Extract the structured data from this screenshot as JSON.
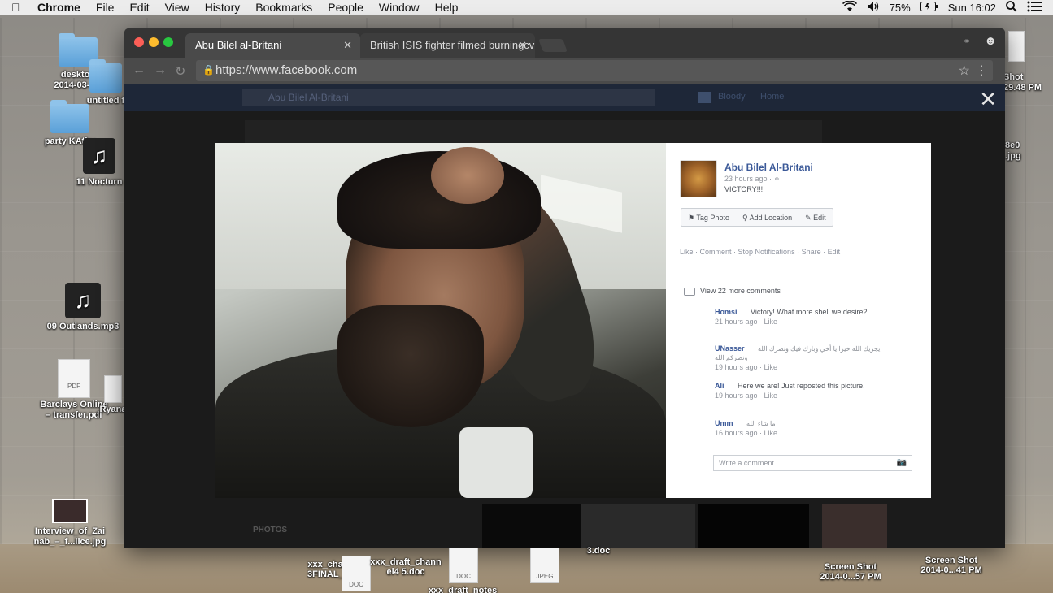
{
  "menubar": {
    "apple_icon": "apple-icon",
    "app": "Chrome",
    "menus": [
      "File",
      "Edit",
      "View",
      "History",
      "Bookmarks",
      "People",
      "Window",
      "Help"
    ],
    "battery": "75%",
    "clock": "Sun 16:02"
  },
  "desktop": {
    "icons": [
      {
        "label": "desktop\n2014-03-2...",
        "kind": "folder"
      },
      {
        "label": "untitled f",
        "kind": "folder"
      },
      {
        "label": "party KAthy",
        "kind": "folder"
      },
      {
        "label": "11 Nocturn",
        "kind": "music"
      },
      {
        "label": "09 Outlands.mp3",
        "kind": "music"
      },
      {
        "label": "Barclays Online\n– transfer.pdf",
        "kind": "pdf"
      },
      {
        "label": "Ryana",
        "kind": "doc"
      },
      {
        "label": "Interview_of_Zai\nnab_–_f...lice.jpg",
        "kind": "photo"
      }
    ],
    "right_labels": [
      "Shot\n29.48 PM",
      "8e0\n.jpg"
    ],
    "bottom_files": [
      {
        "label": "xxx_chan...\n3FINAL_0...",
        "type": "DOC"
      },
      {
        "label": "xxx_draft_chann\nel4 5.doc",
        "type": "DOC"
      },
      {
        "label": "3.doc",
        "type": ""
      },
      {
        "label": "",
        "type": "JPEG"
      },
      {
        "label": "Screen Shot\n2014-0...57 PM",
        "type": ""
      },
      {
        "label": "Screen Shot\n2014-0...41 PM",
        "type": ""
      },
      {
        "label": "xxx_draft_notes",
        "type": ""
      }
    ]
  },
  "browser": {
    "tabs": [
      {
        "title": "Abu Bilel al-Britani",
        "active": true
      },
      {
        "title": "British ISIS fighter filmed burningcv",
        "active": false
      }
    ],
    "url": "https://www.facebook.com"
  },
  "facebook": {
    "search_value": "Abu Bilel Al-Britani",
    "nav_items": [
      "Bloody",
      "Home"
    ],
    "photos_label": "PHOTOS",
    "post": {
      "author": "Abu Bilel Al-Britani",
      "time": "23 hours ago ·",
      "caption": "VICTORY!!!",
      "action_buttons": [
        "Tag Photo",
        "Add Location",
        "Edit"
      ],
      "links": [
        "Like",
        "Comment",
        "Stop Notifications",
        "Share",
        "Edit"
      ],
      "view_more": "View 22 more comments",
      "comments": [
        {
          "name": "Homsi",
          "text": "Victory! What more shell we desire?",
          "time": "21 hours ago · Like"
        },
        {
          "name": "UNasser",
          "text": "يجزيك الله خيرا يا أخي وبارك فيك ونصرك الله",
          "text2": "ونصركم الله",
          "time": "19 hours ago · Like"
        },
        {
          "name": "Ali",
          "text": "Here we are! Just reposted this picture.",
          "time": "19 hours ago · Like"
        },
        {
          "name": "Umm",
          "text": "ما شاء الله",
          "time": "16 hours ago · Like"
        }
      ],
      "write_placeholder": "Write a comment..."
    }
  }
}
